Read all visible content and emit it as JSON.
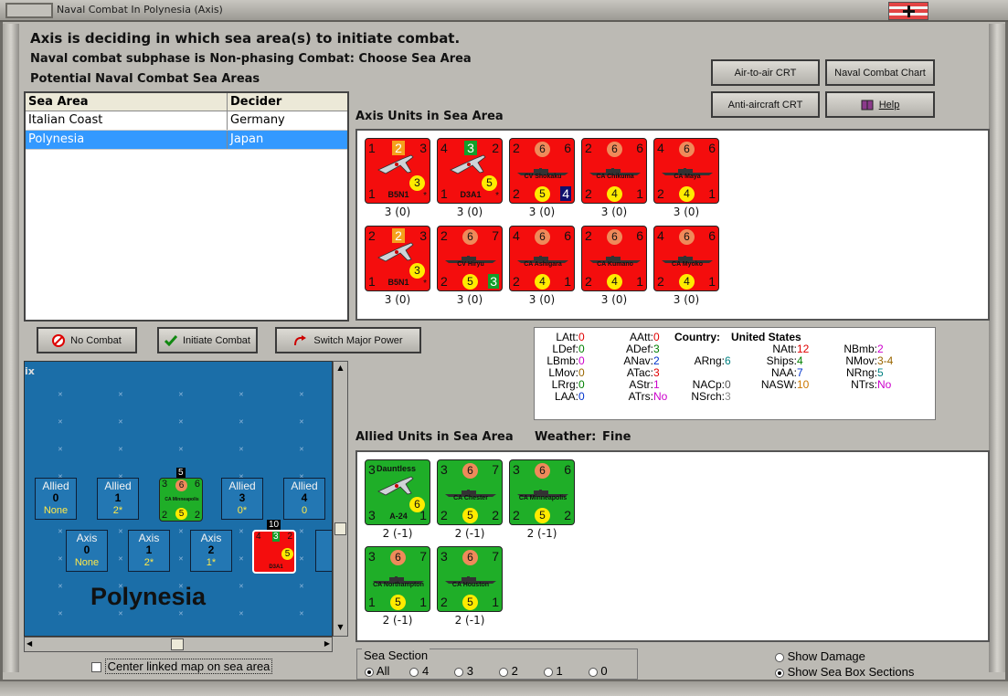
{
  "window": {
    "title": "Naval Combat In Polynesia (Axis)"
  },
  "messages": {
    "line1": "Axis is deciding in which sea area(s) to initiate combat.",
    "line2": "Naval combat subphase is Non-phasing Combat: Choose Sea Area",
    "line3": "Potential Naval Combat Sea Areas"
  },
  "sea_table": {
    "headers": [
      "Sea Area",
      "Decider"
    ],
    "rows": [
      {
        "area": "Italian Coast",
        "decider": "Germany"
      },
      {
        "area": "Polynesia",
        "decider": "Japan"
      }
    ]
  },
  "buttons": {
    "air_to_air": "Air-to-air CRT",
    "naval_chart": "Naval Combat Chart",
    "anti_aircraft": "Anti-aircraft CRT",
    "help": "Help",
    "no_combat": "No Combat",
    "initiate_combat": "Initiate Combat",
    "switch_major": "Switch Major Power"
  },
  "axis_units_label": "Axis Units in Sea Area",
  "axis_units": [
    {
      "kind": "plane",
      "tl": "1",
      "tm": "2",
      "tr": "3",
      "circle": "3",
      "bl": "1",
      "name": "B5N1",
      "br": "*",
      "under": "3 (0)"
    },
    {
      "kind": "plane",
      "tl": "4",
      "tm": "3",
      "tr": "2",
      "circle": "5",
      "bl": "1",
      "name": "D3A1",
      "br": "*",
      "under": "3 (0)"
    },
    {
      "kind": "ship",
      "tl": "2",
      "tm": "6",
      "tr": "6",
      "bm": "5",
      "bl": "2",
      "name": "CV Shokaku",
      "br": "4",
      "under": "3 (0)"
    },
    {
      "kind": "ship",
      "tl": "2",
      "tm": "6",
      "tr": "6",
      "bm": "4",
      "bl": "2",
      "name": "CA Chikuma",
      "br": "1",
      "under": "3 (0)"
    },
    {
      "kind": "ship",
      "tl": "4",
      "tm": "6",
      "tr": "6",
      "bm": "4",
      "bl": "2",
      "name": "CA Maya",
      "br": "1",
      "under": "3 (0)"
    },
    {
      "kind": "plane",
      "tl": "2",
      "tm": "2",
      "tr": "3",
      "circle": "3",
      "bl": "1",
      "name": "B5N1",
      "br": "*",
      "under": "3 (0)"
    },
    {
      "kind": "ship",
      "tl": "2",
      "tm": "6",
      "tr": "7",
      "bm": "5",
      "bl": "2",
      "name": "CV Hiryu",
      "br": "3",
      "under": "3 (0)"
    },
    {
      "kind": "ship",
      "tl": "4",
      "tm": "6",
      "tr": "6",
      "bm": "4",
      "bl": "2",
      "name": "CA Ashigara",
      "br": "1",
      "under": "3 (0)"
    },
    {
      "kind": "ship",
      "tl": "2",
      "tm": "6",
      "tr": "6",
      "bm": "4",
      "bl": "2",
      "name": "CA Kumano",
      "br": "1",
      "under": "3 (0)"
    },
    {
      "kind": "ship",
      "tl": "4",
      "tm": "6",
      "tr": "6",
      "bm": "4",
      "bl": "2",
      "name": "CA Myoko",
      "br": "1",
      "under": "3 (0)"
    }
  ],
  "stats": {
    "country_label": "Country:",
    "country": "United States",
    "items": [
      {
        "k": "LAtt:",
        "v": "0",
        "c": "#e00000"
      },
      {
        "k": "LDef:",
        "v": "0",
        "c": "#008000"
      },
      {
        "k": "LBmb:",
        "v": "0",
        "c": "#cc00cc"
      },
      {
        "k": "LMov:",
        "v": "0",
        "c": "#996600"
      },
      {
        "k": "LRrg:",
        "v": "0",
        "c": "#008000"
      },
      {
        "k": "LAA:",
        "v": "0",
        "c": "#0033cc"
      },
      {
        "k": "AAtt:",
        "v": "0",
        "c": "#e00000"
      },
      {
        "k": "ADef:",
        "v": "3",
        "c": "#008000"
      },
      {
        "k": "ANav:",
        "v": "2",
        "c": "#0033cc"
      },
      {
        "k": "ATac:",
        "v": "3",
        "c": "#e00000"
      },
      {
        "k": "AStr:",
        "v": "1",
        "c": "#cc00cc"
      },
      {
        "k": "ATrs:",
        "v": "No",
        "c": "#cc00cc"
      },
      {
        "k": "ARng:",
        "v": "6",
        "c": "#008080"
      },
      {
        "k": "NACp:",
        "v": "0",
        "c": "#555555"
      },
      {
        "k": "NSrch:",
        "v": "3",
        "c": "#888888"
      },
      {
        "k": "NAtt:",
        "v": "12",
        "c": "#e00000"
      },
      {
        "k": "Ships:",
        "v": "4",
        "c": "#008000"
      },
      {
        "k": "NAA:",
        "v": "7",
        "c": "#0033cc"
      },
      {
        "k": "NASW:",
        "v": "10",
        "c": "#cc7700"
      },
      {
        "k": "NBmb:",
        "v": "2",
        "c": "#cc00cc"
      },
      {
        "k": "NMov:",
        "v": "3-4",
        "c": "#996600"
      },
      {
        "k": "NRng:",
        "v": "5",
        "c": "#008080"
      },
      {
        "k": "NTrs:",
        "v": "No",
        "c": "#cc00cc"
      }
    ]
  },
  "allied_units_label": "Allied Units in Sea Area",
  "weather_label": "Weather:",
  "weather": "Fine",
  "allied_units": [
    {
      "kind": "plane",
      "tl": "3",
      "tm": "Dauntless",
      "tr": "",
      "circle": "6",
      "bl": "3",
      "name": "A-24",
      "br": "1",
      "under": "2 (-1)"
    },
    {
      "kind": "ship",
      "tl": "3",
      "tm": "6",
      "tr": "7",
      "bm": "5",
      "bl": "2",
      "name": "CA Chester",
      "br": "2",
      "under": "2 (-1)"
    },
    {
      "kind": "ship",
      "tl": "3",
      "tm": "6",
      "tr": "6",
      "bm": "5",
      "bl": "2",
      "name": "CA Minneapolis",
      "br": "2",
      "under": "2 (-1)"
    },
    {
      "kind": "ship",
      "tl": "3",
      "tm": "6",
      "tr": "7",
      "bm": "5",
      "bl": "1",
      "name": "CA Northampton",
      "br": "1",
      "under": "2 (-1)"
    },
    {
      "kind": "ship",
      "tl": "3",
      "tm": "6",
      "tr": "7",
      "bm": "5",
      "bl": "2",
      "name": "CA Houston",
      "br": "1",
      "under": "2 (-1)"
    }
  ],
  "map": {
    "corner_label": "ix",
    "sea_name": "Polynesia",
    "allied_boxes": [
      {
        "label": "Allied",
        "num": "0",
        "sub": "None"
      },
      {
        "label": "Allied",
        "num": "1",
        "sub": "2*"
      },
      {
        "label": "Allied",
        "num": "3",
        "sub": "0*"
      },
      {
        "label": "Allied",
        "num": "4",
        "sub": "0"
      }
    ],
    "axis_boxes": [
      {
        "label": "Axis",
        "num": "0",
        "sub": "None"
      },
      {
        "label": "Axis",
        "num": "1",
        "sub": "2*"
      },
      {
        "label": "Axis",
        "num": "2",
        "sub": "1*"
      },
      {
        "label": "A"
      }
    ],
    "allied_stack": {
      "count": "5",
      "tl": "3",
      "tm": "6",
      "tr": "6",
      "bm": "5",
      "bl": "2",
      "br": "2",
      "name": "CA Minneapolis"
    },
    "axis_stack": {
      "count": "10",
      "tl": "4",
      "tm": "3",
      "tr": "2",
      "circle": "5",
      "name": "D3A1"
    }
  },
  "center_checkbox_label": "Center linked map on sea area",
  "sea_section": {
    "label": "Sea Section",
    "options": [
      "All",
      "4",
      "3",
      "2",
      "1",
      "0"
    ],
    "selected": "All"
  },
  "show_damage": "Show Damage",
  "show_sections": "Show Sea Box Sections"
}
